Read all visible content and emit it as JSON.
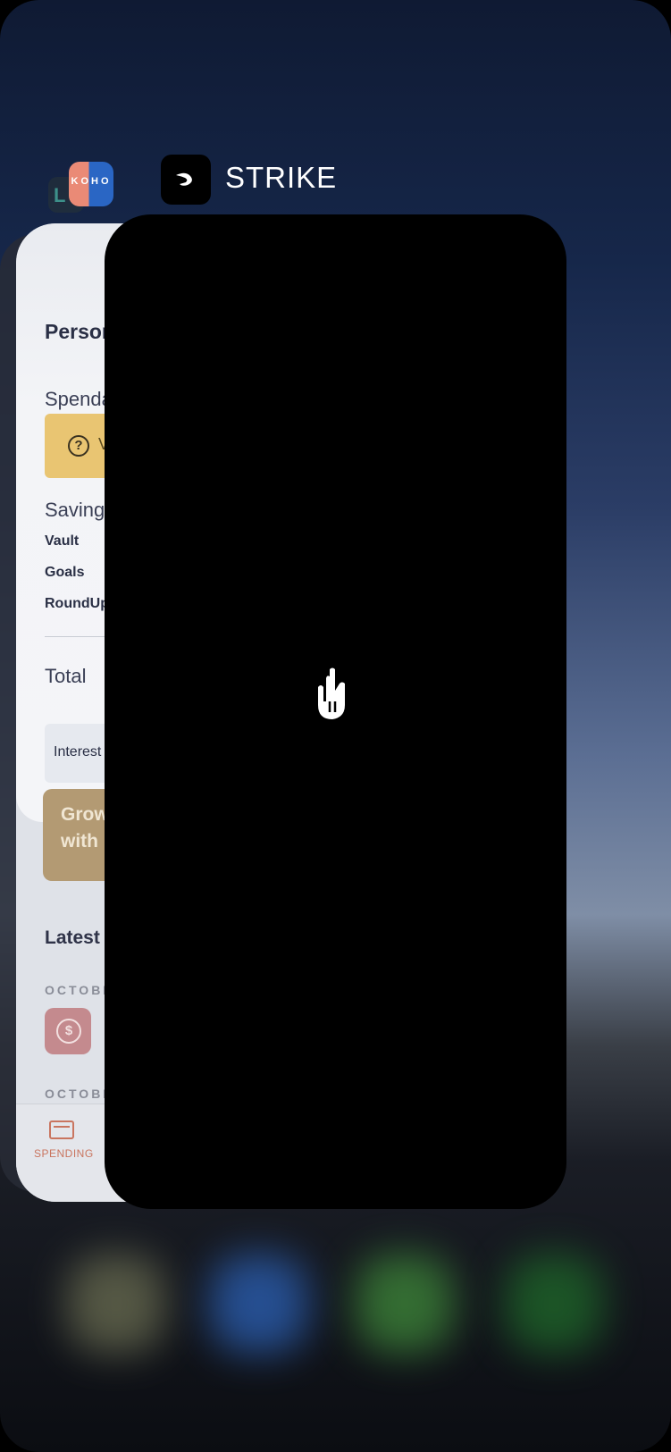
{
  "app_switcher": {
    "front_app": {
      "name": "STRIKE"
    },
    "back_app": {
      "icon_text": "KOHO",
      "personal_heading": "Persor",
      "spendable_label": "Spenda",
      "help_banner_text": "V",
      "help_icon": "?",
      "savings_label": "Savings",
      "vault_label": "Vault",
      "goals_label": "Goals",
      "roundup_label": "RoundUp",
      "total_label": "Total",
      "interest_label": "Interest",
      "grow_banner_text": "Grow\nwith",
      "latest_heading": "Latest",
      "date_header_1": "OCTOBE",
      "date_header_2": "OCTOBE",
      "txn_icon": "$",
      "tab_spending_label": "SPENDING"
    },
    "colors": {
      "koho_accent": "#ea8a76",
      "koho_blue": "#2a66c4",
      "help_banner": "#e9c572",
      "spending_tab": "#c9755f"
    }
  }
}
